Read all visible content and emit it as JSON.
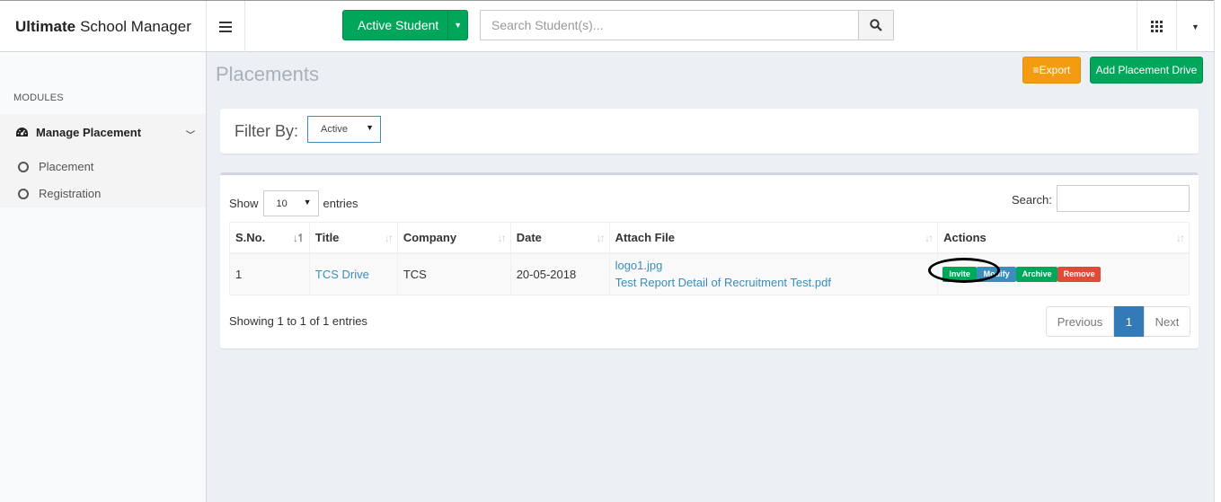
{
  "app": {
    "title_bold": "Ultimate",
    "title_rest": "School Manager"
  },
  "header": {
    "active_student_label": "Active Student",
    "search_placeholder": "Search Student(s)..."
  },
  "sidebar": {
    "section_label": "MODULES",
    "group_label": "Manage Placement",
    "items": [
      {
        "label": "Placement"
      },
      {
        "label": "Registration"
      }
    ]
  },
  "page": {
    "title": "Placements",
    "export_label": "Export",
    "add_label": "Add Placement Drive"
  },
  "filter": {
    "label": "Filter By:",
    "value": "Active"
  },
  "table": {
    "show_label": "Show",
    "entries_label": "entries",
    "length_value": "10",
    "search_label": "Search:",
    "columns": [
      "S.No.",
      "Title",
      "Company",
      "Date",
      "Attach File",
      "Actions"
    ],
    "rows": [
      {
        "sno": "1",
        "title": "TCS Drive",
        "company": "TCS",
        "date": "20-05-2018",
        "files": [
          "logo1.jpg",
          "Test Report Detail of Recruitment Test.pdf"
        ],
        "actions": [
          "Invite",
          "Modify",
          "Archive",
          "Remove"
        ]
      }
    ],
    "info": "Showing 1 to 1 of 1 entries",
    "pagination": {
      "prev": "Previous",
      "current": "1",
      "next": "Next"
    }
  },
  "colors": {
    "green": "#00a65a",
    "orange": "#f39c12",
    "blue": "#3c8dbc",
    "red": "#dd4b39",
    "page_bg": "#ecf0f5"
  },
  "icons": [
    "hamburger-icon",
    "search-icon",
    "apps-grid-icon",
    "chevron-down-icon",
    "dashboard-icon",
    "circle-icon",
    "sort-icon"
  ]
}
